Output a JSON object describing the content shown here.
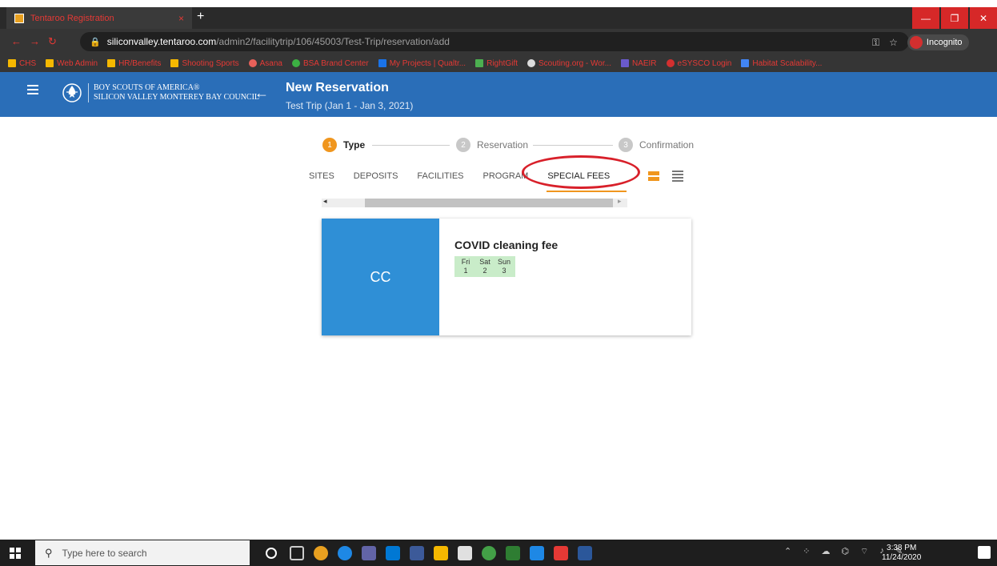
{
  "browser": {
    "tab_title": "Tentaroo Registration",
    "tab_close": "×",
    "new_tab": "+",
    "url_host": "siliconvalley.tentaroo.com",
    "url_path": "/admin2/facilitytrip/106/45003/Test-Trip/reservation/add",
    "incognito": "Incognito",
    "bookmarks": [
      "CHS",
      "Web Admin",
      "HR/Benefits",
      "Shooting Sports",
      "Asana",
      "BSA Brand Center",
      "My Projects | Qualtr...",
      "RightGift",
      "Scouting.org - Wor...",
      "NAEIR",
      "eSYSCO Login",
      "Habitat Scalability..."
    ]
  },
  "header": {
    "org_line1": "BOY SCOUTS OF AMERICA®",
    "org_line2": "SILICON VALLEY MONTEREY BAY COUNCIL",
    "title": "New Reservation",
    "subtitle": "Test Trip (Jan 1 - Jan 3, 2021)"
  },
  "stepper": [
    {
      "num": "1",
      "label": "Type"
    },
    {
      "num": "2",
      "label": "Reservation"
    },
    {
      "num": "3",
      "label": "Confirmation"
    }
  ],
  "tabs": [
    "SITES",
    "DEPOSITS",
    "FACILITIES",
    "PROGRAM",
    "SPECIAL FEES"
  ],
  "scroll": {
    "left": "◂",
    "right": "▸"
  },
  "card": {
    "initials": "CC",
    "title": "COVID cleaning fee",
    "days": [
      {
        "dow": "Fri",
        "date": "1"
      },
      {
        "dow": "Sat",
        "date": "2"
      },
      {
        "dow": "Sun",
        "date": "3"
      }
    ]
  },
  "taskbar": {
    "search_placeholder": "Type here to search",
    "time": "3:38 PM",
    "date": "11/24/2020"
  },
  "colors": {
    "header_blue": "#2a6eb8",
    "accent_orange": "#f0961e",
    "card_blue": "#2f8fd6",
    "annotation_red": "#d8202a",
    "day_green": "#c9ecc9"
  }
}
